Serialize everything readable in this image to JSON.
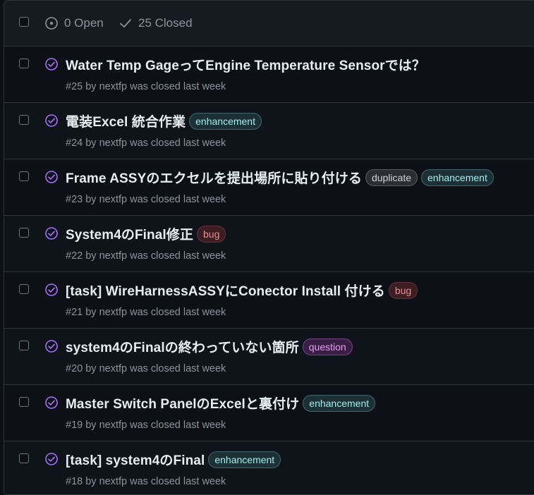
{
  "header": {
    "open_label": "0 Open",
    "closed_label": "25 Closed"
  },
  "issues": [
    {
      "title": "Water Temp GageってEngine Temperature Sensorでは？",
      "meta": "#25 by nextfp was closed last week",
      "labels": []
    },
    {
      "title": "電装Excel 統合作業",
      "meta": "#24 by nextfp was closed last week",
      "labels": [
        "enhancement"
      ]
    },
    {
      "title": "Frame ASSYのエクセルを提出場所に貼り付ける",
      "meta": "#23 by nextfp was closed last week",
      "labels": [
        "duplicate",
        "enhancement"
      ]
    },
    {
      "title": "System4のFinal修正",
      "meta": "#22 by nextfp was closed last week",
      "labels": [
        "bug"
      ]
    },
    {
      "title": "[task] WireHarnessASSYにConector Install 付ける",
      "meta": "#21 by nextfp was closed last week",
      "labels": [
        "bug"
      ]
    },
    {
      "title": "system4のFinalの終わっていない箇所",
      "meta": "#20 by nextfp was closed last week",
      "labels": [
        "question"
      ]
    },
    {
      "title": "Master Switch PanelのExcelと裏付け",
      "meta": "#19 by nextfp was closed last week",
      "labels": [
        "enhancement"
      ]
    },
    {
      "title": "[task] system4のFinal",
      "meta": "#18 by nextfp was closed last week",
      "labels": [
        "enhancement"
      ]
    }
  ],
  "colors": {
    "background": "#0d1117",
    "closed_icon": "#a371f7",
    "border": "#30363d"
  }
}
